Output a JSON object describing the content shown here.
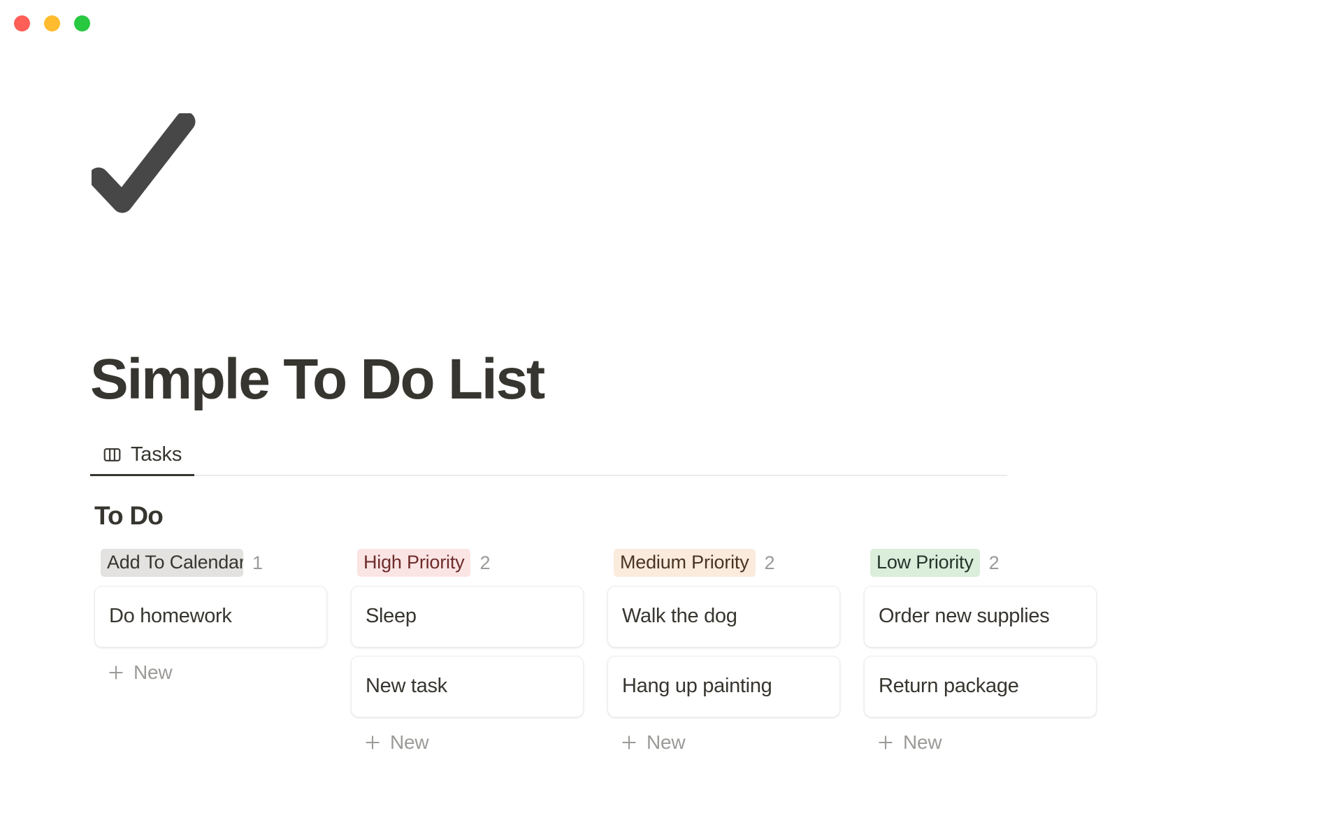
{
  "window": {
    "traffic_lights": [
      {
        "name": "close",
        "color": "#ff5f57"
      },
      {
        "name": "minimize",
        "color": "#febc2e"
      },
      {
        "name": "maximize",
        "color": "#28c840"
      }
    ]
  },
  "page": {
    "icon": "checkmark-icon",
    "title": "Simple To Do List"
  },
  "tabs": [
    {
      "label": "Tasks",
      "icon": "board-view-icon",
      "active": true
    }
  ],
  "group": {
    "title": "To Do"
  },
  "board": {
    "columns": [
      {
        "tag": "Add To Calendar",
        "count": "1",
        "tag_bg": "#e3e2e0",
        "tag_color": "#37352f",
        "truncated": true,
        "cards": [
          {
            "title": "Do homework"
          }
        ],
        "new_label": "New"
      },
      {
        "tag": "High Priority",
        "count": "2",
        "tag_bg": "#fbe4e4",
        "tag_color": "#6e2c2c",
        "truncated": false,
        "cards": [
          {
            "title": "Sleep"
          },
          {
            "title": "New task"
          }
        ],
        "new_label": "New"
      },
      {
        "tag": "Medium Priority",
        "count": "2",
        "tag_bg": "#faebdd",
        "tag_color": "#4a3422",
        "truncated": false,
        "cards": [
          {
            "title": "Walk the dog"
          },
          {
            "title": "Hang up painting"
          }
        ],
        "new_label": "New"
      },
      {
        "tag": "Low Priority",
        "count": "2",
        "tag_bg": "#dbeddb",
        "tag_color": "#25342a",
        "truncated": false,
        "cards": [
          {
            "title": "Order new supplies"
          },
          {
            "title": "Return package"
          }
        ],
        "new_label": "New"
      }
    ]
  }
}
